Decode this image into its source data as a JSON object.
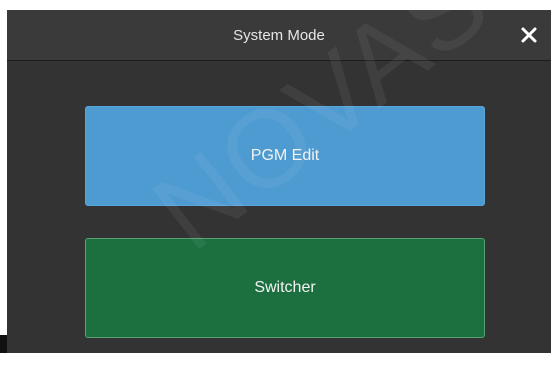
{
  "dialog": {
    "title": "System Mode",
    "close_icon": "close-icon"
  },
  "modes": {
    "pgm_edit_label": "PGM Edit",
    "switcher_label": "Switcher"
  },
  "colors": {
    "dialog_bg": "#353535",
    "pgm_edit_button": "#4e9bd1",
    "switcher_button": "#1c7040"
  },
  "watermark": {
    "text": "NOVASTAR"
  }
}
